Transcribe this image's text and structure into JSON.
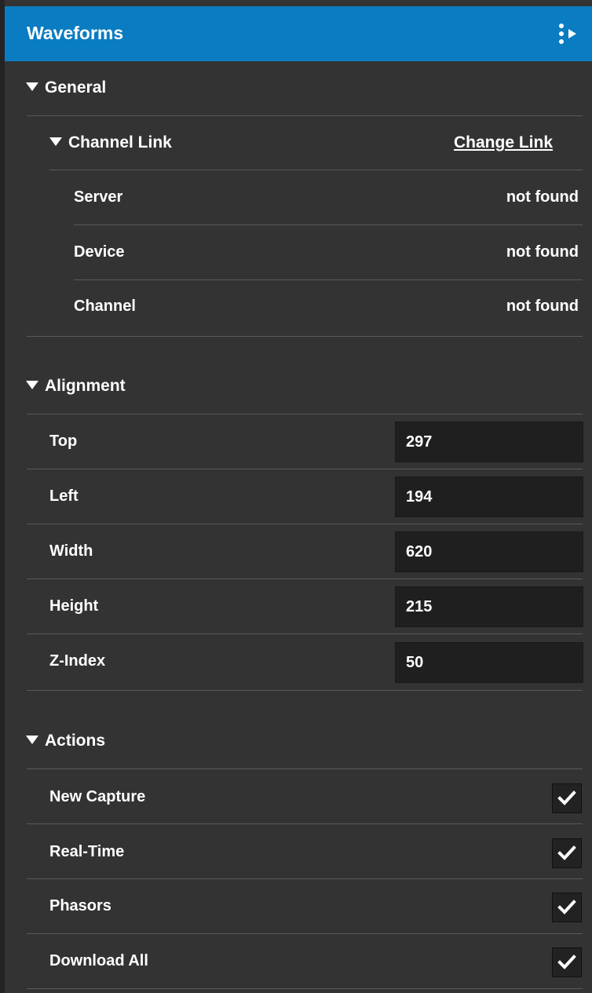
{
  "header": {
    "title": "Waveforms",
    "menu_icon": "dots-arrow-menu-icon",
    "background_color": "#0a7cc1"
  },
  "general": {
    "heading": "General",
    "channel_link": {
      "heading": "Channel Link",
      "change_link_label": "Change Link",
      "rows": [
        {
          "label": "Server",
          "value": "not found"
        },
        {
          "label": "Device",
          "value": "not found"
        },
        {
          "label": "Channel",
          "value": "not found"
        }
      ]
    }
  },
  "alignment": {
    "heading": "Alignment",
    "fields": [
      {
        "label": "Top",
        "value": "297"
      },
      {
        "label": "Left",
        "value": "194"
      },
      {
        "label": "Width",
        "value": "620"
      },
      {
        "label": "Height",
        "value": "215"
      },
      {
        "label": "Z-Index",
        "value": "50"
      }
    ]
  },
  "actions": {
    "heading": "Actions",
    "items": [
      {
        "label": "New Capture",
        "checked": true
      },
      {
        "label": "Real-Time",
        "checked": true
      },
      {
        "label": "Phasors",
        "checked": true
      },
      {
        "label": "Download All",
        "checked": true
      }
    ]
  },
  "colors": {
    "panel_background": "#333333",
    "input_background": "#1f1f1f",
    "divider": "#5a5a5a"
  }
}
